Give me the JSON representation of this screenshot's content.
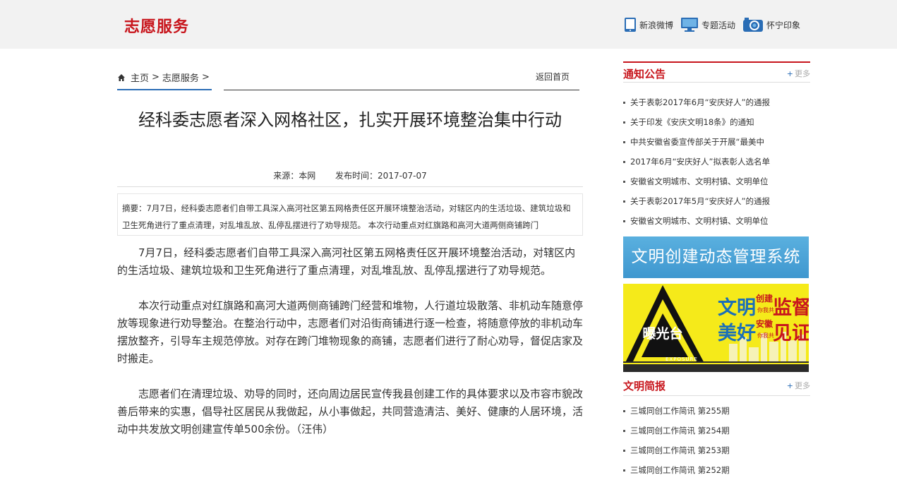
{
  "header": {
    "site_title": "志愿服务",
    "links": [
      {
        "label": "新浪微博",
        "icon": "tablet-icon"
      },
      {
        "label": "专题活动",
        "icon": "monitor-icon"
      },
      {
        "label": "怀宁印象",
        "icon": "camera-icon"
      }
    ]
  },
  "breadcrumb": {
    "home": "主页",
    "sep": ">",
    "section": "志愿服务",
    "tail": ">",
    "back_home": "返回首页"
  },
  "article": {
    "title": "经科委志愿者深入网格社区，扎实开展环境整治集中行动",
    "source": "来源：本网",
    "date": "发布时间：2017-07-07",
    "summary": "摘要：7月7日，经科委志愿者们自带工具深入高河社区第五网格责任区开展环境整治活动，对辖区内的生活垃圾、建筑垃圾和卫生死角进行了重点清理，对乱堆乱放、乱停乱摆进行了劝导规范。 本次行动重点对红旗路和高河大道两侧商铺跨门",
    "paragraphs": [
      "7月7日，经科委志愿者们自带工具深入高河社区第五网格责任区开展环境整治活动，对辖区内的生活垃圾、建筑垃圾和卫生死角进行了重点清理，对乱堆乱放、乱停乱摆进行了劝导规范。",
      "本次行动重点对红旗路和高河大道两侧商铺跨门经营和堆物，人行道垃圾散落、非机动车随意停放等现象进行劝导整治。在整治行动中，志愿者们对沿街商铺进行逐一检查，将随意停放的非机动车摆放整齐，引导车主规范停放。对存在跨门堆物现象的商铺，志愿者们进行了耐心劝导，督促店家及时搬走。",
      "志愿者们在清理垃圾、劝导的同时，还向周边居民宣传我县创建工作的具体要求以及市容市貌改善后带来的实惠，倡导社区居民从我做起，从小事做起，共同营造清洁、美好、健康的人居环境，活动中共发放文明创建宣传单500余份。（汪伟）"
    ]
  },
  "sidebar": {
    "notice": {
      "title": "通知公告",
      "more": "更多",
      "plus": "+",
      "items": [
        "关于表彰2017年6月“安庆好人”的通报",
        "关于印发《安庆文明18条》的通知",
        "中共安徽省委宣传部关于开展“最美中",
        "2017年6月“安庆好人”拟表彰人选名单",
        "安徽省文明城市、文明村镇、文明单位",
        "关于表彰2017年5月“安庆好人”的通报",
        "安徽省文明城市、文明村镇、文明单位"
      ]
    },
    "banner_system": "文明创建动态管理系统",
    "banner_expose": {
      "badge": "曝光台",
      "line1a": "文明",
      "line1b": "创建",
      "line1c": "监督",
      "line2a": "美好",
      "line2b": "安徽",
      "line2c": "见证",
      "small1": "你我共",
      "small2": "你我共",
      "tag": "EXPOSURE"
    },
    "brief": {
      "title": "文明简报",
      "more": "更多",
      "plus": "+",
      "items": [
        "三城同创工作简讯 第255期",
        "三城同创工作简讯 第254期",
        "三城同创工作简讯 第253期",
        "三城同创工作简讯 第252期"
      ]
    }
  }
}
